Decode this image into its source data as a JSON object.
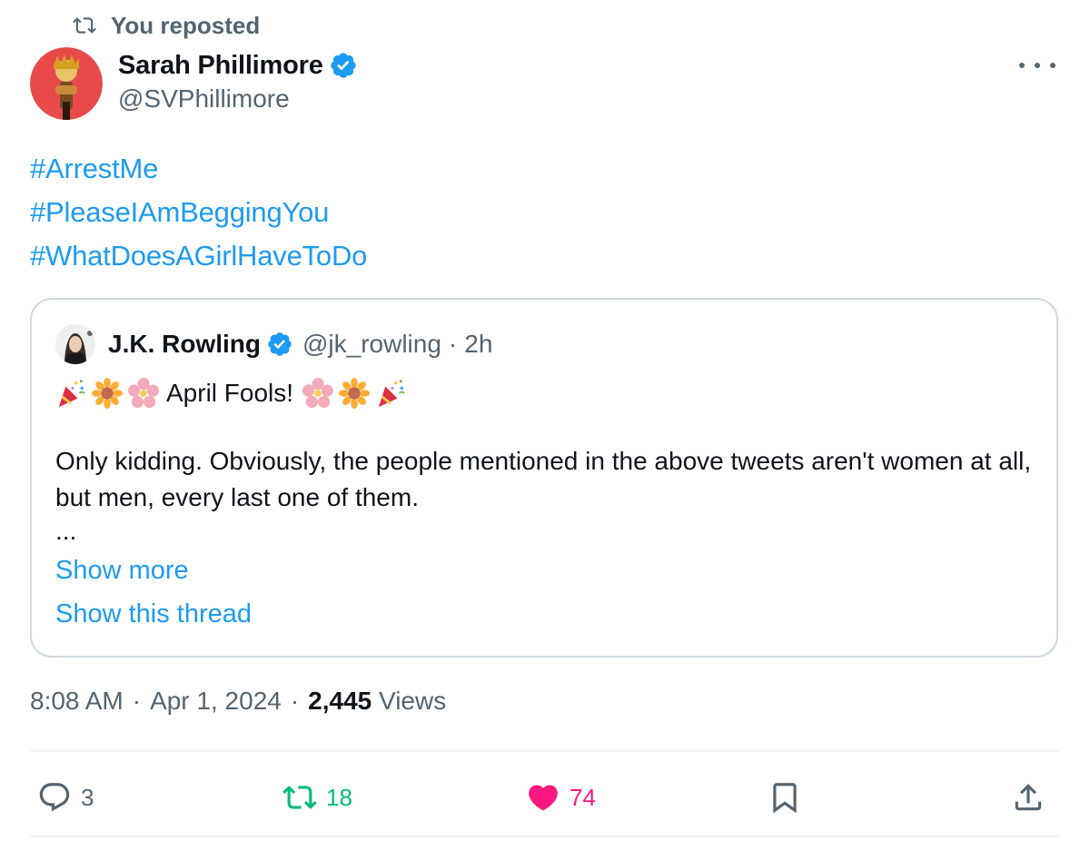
{
  "repost": {
    "label": "You reposted"
  },
  "tweet": {
    "author_name": "Sarah Phillimore",
    "author_handle": "@SVPhillimore",
    "hashtags": [
      "#ArrestMe",
      "#PleaseIAmBeggingYou",
      "#WhatDoesAGirlHaveToDo"
    ],
    "time": "8:08 AM",
    "date": "Apr 1, 2024",
    "views_count": "2,445",
    "views_label": "Views",
    "separator": "·"
  },
  "quote": {
    "author_name": "J.K. Rowling",
    "author_handle": "@jk_rowling",
    "separator": "·",
    "age": "2h",
    "headline": "April Fools!",
    "body": "Only kidding. Obviously, the people mentioned in the above tweets aren't women at all, but men, every last one of them.",
    "ellipsis": "...",
    "show_more": "Show more",
    "show_thread": "Show this thread"
  },
  "actions": {
    "replies": "3",
    "reposts": "18",
    "likes": "74"
  },
  "colors": {
    "link": "#1d9bf0",
    "muted": "#536471",
    "repost_green": "#00ba7c",
    "like_pink": "#f91880",
    "border": "#cfd9de"
  },
  "icons": [
    "repost-icon",
    "verified-badge-icon",
    "more-icon",
    "party-popper-emoji",
    "sunflower-emoji",
    "cherry-blossom-emoji",
    "reply-icon",
    "like-heart-icon",
    "bookmark-icon",
    "share-icon"
  ]
}
